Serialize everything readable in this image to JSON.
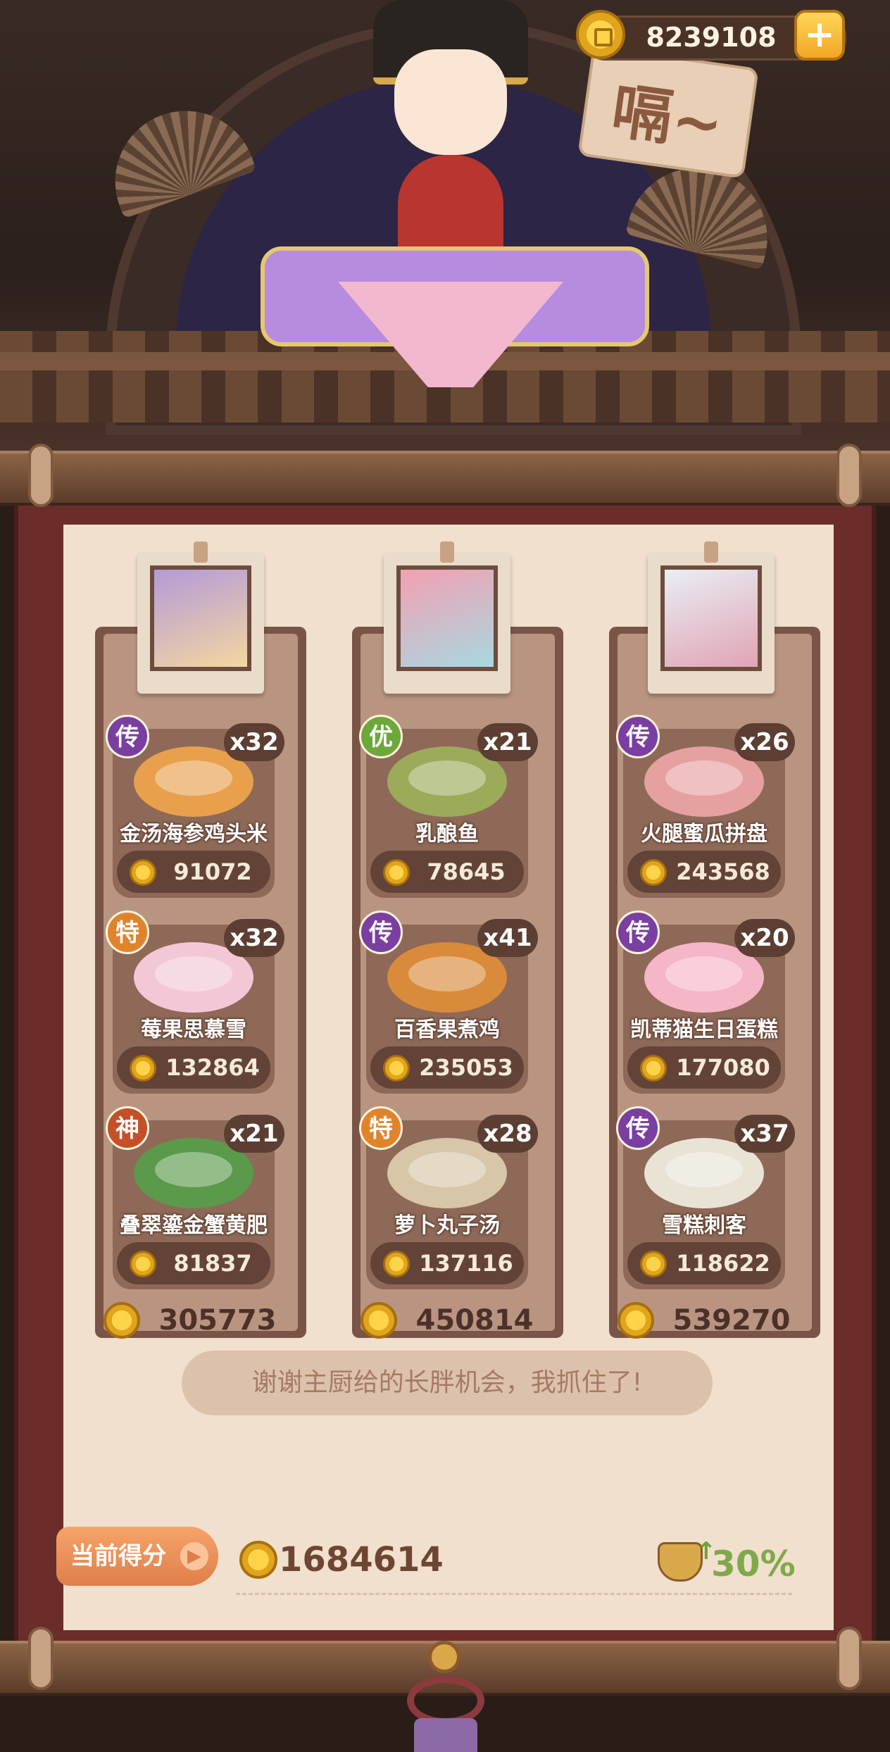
{
  "hud": {
    "coins": "8239108",
    "add_button": "+"
  },
  "scene": {
    "sign_text": "嗝~"
  },
  "columns": [
    {
      "dishes": [
        {
          "grade": "传",
          "grade_color": "#7a3fa0",
          "qty": "x32",
          "name": "金汤海参鸡头米",
          "score": "91072",
          "food_color": "#e8a04c"
        },
        {
          "grade": "特",
          "grade_color": "#e0842c",
          "qty": "x32",
          "name": "莓果思慕雪",
          "score": "132864",
          "food_color": "#f3c8d6"
        },
        {
          "grade": "神",
          "grade_color": "#c4502a",
          "qty": "x21",
          "name": "叠翠鎏金蟹黄肥",
          "score": "81837",
          "food_color": "#5a9a4a"
        }
      ],
      "total": "305773"
    },
    {
      "dishes": [
        {
          "grade": "优",
          "grade_color": "#6da83a",
          "qty": "x21",
          "name": "乳酿鱼",
          "score": "78645",
          "food_color": "#9cab5a"
        },
        {
          "grade": "传",
          "grade_color": "#7a3fa0",
          "qty": "x41",
          "name": "百香果煮鸡",
          "score": "235053",
          "food_color": "#d98a3a"
        },
        {
          "grade": "特",
          "grade_color": "#e0842c",
          "qty": "x28",
          "name": "萝卜丸子汤",
          "score": "137116",
          "food_color": "#d7c6a8"
        }
      ],
      "total": "450814"
    },
    {
      "dishes": [
        {
          "grade": "传",
          "grade_color": "#7a3fa0",
          "qty": "x26",
          "name": "火腿蜜瓜拼盘",
          "score": "243568",
          "food_color": "#e6a0a0"
        },
        {
          "grade": "传",
          "grade_color": "#7a3fa0",
          "qty": "x20",
          "name": "凯蒂猫生日蛋糕",
          "score": "177080",
          "food_color": "#f5b6c8"
        },
        {
          "grade": "传",
          "grade_color": "#7a3fa0",
          "qty": "x37",
          "name": "雪糕刺客",
          "score": "118622",
          "food_color": "#e9e3d6"
        }
      ],
      "total": "539270"
    }
  ],
  "quote": "谢谢主厨给的长胖机会，我抓住了!",
  "footer": {
    "score_label": "当前得分",
    "arrow": "▶",
    "score_value": "1684614",
    "percent": "30%"
  }
}
